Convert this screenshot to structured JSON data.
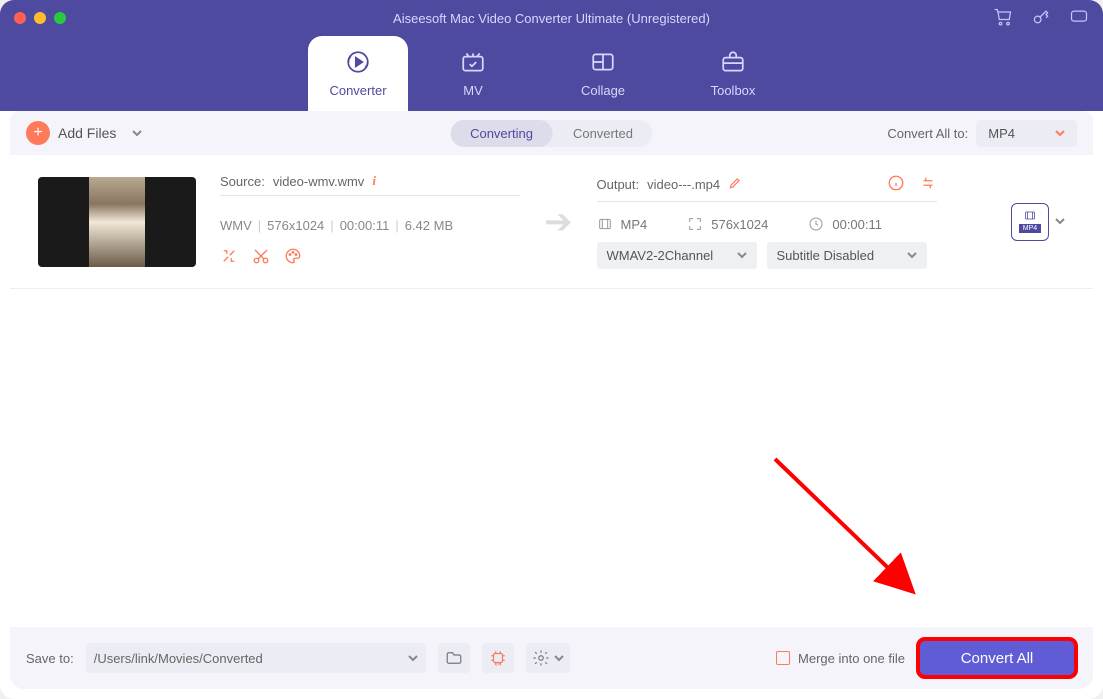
{
  "window": {
    "title": "Aiseesoft Mac Video Converter Ultimate (Unregistered)"
  },
  "nav": {
    "converter": "Converter",
    "mv": "MV",
    "collage": "Collage",
    "toolbox": "Toolbox"
  },
  "topbar": {
    "add_files": "Add Files",
    "seg_converting": "Converting",
    "seg_converted": "Converted",
    "convert_all_to_label": "Convert All to:",
    "convert_all_to_value": "MP4"
  },
  "file": {
    "source_label": "Source:",
    "source_name": "video-wmv.wmv",
    "format": "WMV",
    "resolution": "576x1024",
    "duration": "00:00:11",
    "size": "6.42 MB",
    "output_label": "Output:",
    "output_name": "video---.mp4",
    "out_format": "MP4",
    "out_resolution": "576x1024",
    "out_duration": "00:00:11",
    "audio_select": "WMAV2-2Channel",
    "subtitle_select": "Subtitle Disabled",
    "format_tile_label": "MP4"
  },
  "bottom": {
    "save_to_label": "Save to:",
    "save_path": "/Users/link/Movies/Converted",
    "merge_label": "Merge into one file",
    "convert_all": "Convert All"
  }
}
